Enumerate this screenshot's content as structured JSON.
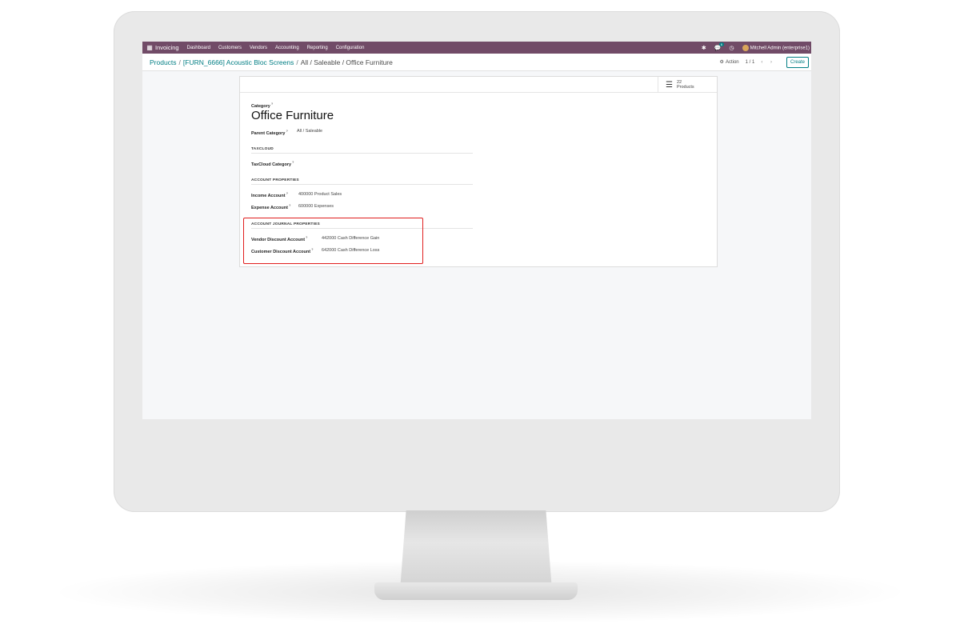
{
  "navbar": {
    "app_name": "Invoicing",
    "menus": [
      "Dashboard",
      "Customers",
      "Vendors",
      "Accounting",
      "Reporting",
      "Configuration"
    ],
    "chat_badge": "6",
    "user": "Mitchell Admin (enterprise1)"
  },
  "breadcrumb": {
    "items": [
      "Products",
      "[FURN_6666] Acoustic Bloc Screens"
    ],
    "separator": "/",
    "current": "All / Saleable / Office Furniture"
  },
  "control": {
    "action_label": "Action",
    "pager": "1 / 1",
    "pager_arrows": "‹ ›",
    "create_label": "Create"
  },
  "stat_button": {
    "count": "22",
    "label": "Products"
  },
  "form": {
    "category_label": "Category",
    "name": "Office Furniture",
    "parent_category_label": "Parent Category",
    "parent_category_value": "All / Saleable",
    "taxcloud_title": "TAXCLOUD",
    "taxcloud_category_label": "TaxCloud Category",
    "account_properties_title": "ACCOUNT PROPERTIES",
    "income_account_label": "Income Account",
    "income_account_value": "400000 Product Sales",
    "expense_account_label": "Expense Account",
    "expense_account_value": "600000 Expenses",
    "journal_properties_title": "ACCOUNT JOURNAL PROPERTIES",
    "vendor_discount_label": "Vendor Discount Account",
    "vendor_discount_value": "442000 Cash Difference Gain",
    "customer_discount_label": "Customer Discount Account",
    "customer_discount_value": "642000 Cash Difference Loss",
    "help_mark": "?"
  },
  "colors": {
    "navbar": "#714b67",
    "link": "#017e84",
    "highlight": "#e01e1e"
  }
}
